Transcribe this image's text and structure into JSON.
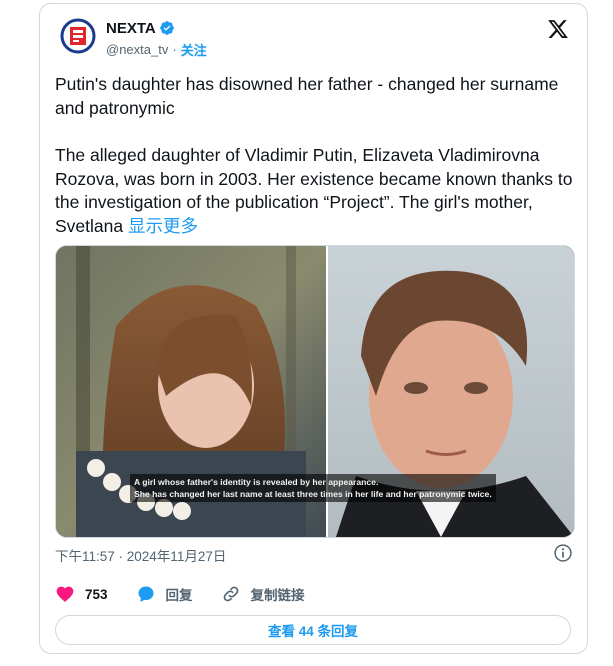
{
  "author": {
    "display_name": "NEXTA",
    "handle": "@nexta_tv",
    "separator": "·",
    "follow_label": "关注"
  },
  "tweet": {
    "headline": "Putin's daughter has disowned her father - changed her surname and patronymic",
    "body": "The alleged daughter of Vladimir Putin, Elizaveta Vladimirovna Rozova, was born in 2003. Her existence became known thanks to the investigation of the publication “Project”. The girl's mother, Svetlana",
    "show_more": "显示更多"
  },
  "media": {
    "caption_line1": "A girl whose father's identity is revealed by her appearance.",
    "caption_line2": "She has changed her last name at least three times in her life and her patronymic twice."
  },
  "timestamp": "下午11:57 · 2024年11月27日",
  "actions": {
    "like_count": "753",
    "reply_label": "回复",
    "copy_link_label": "复制链接"
  },
  "view_replies_label": "查看 44 条回复",
  "colors": {
    "accent": "#1d9bf0",
    "like": "#f91880",
    "text": "#0f1419",
    "muted": "#536471",
    "border": "#cfd9de"
  },
  "icons": [
    "nexta-logo-icon",
    "verified-badge-icon",
    "x-logo-icon",
    "info-icon",
    "heart-icon",
    "reply-bubble-icon",
    "link-icon"
  ]
}
